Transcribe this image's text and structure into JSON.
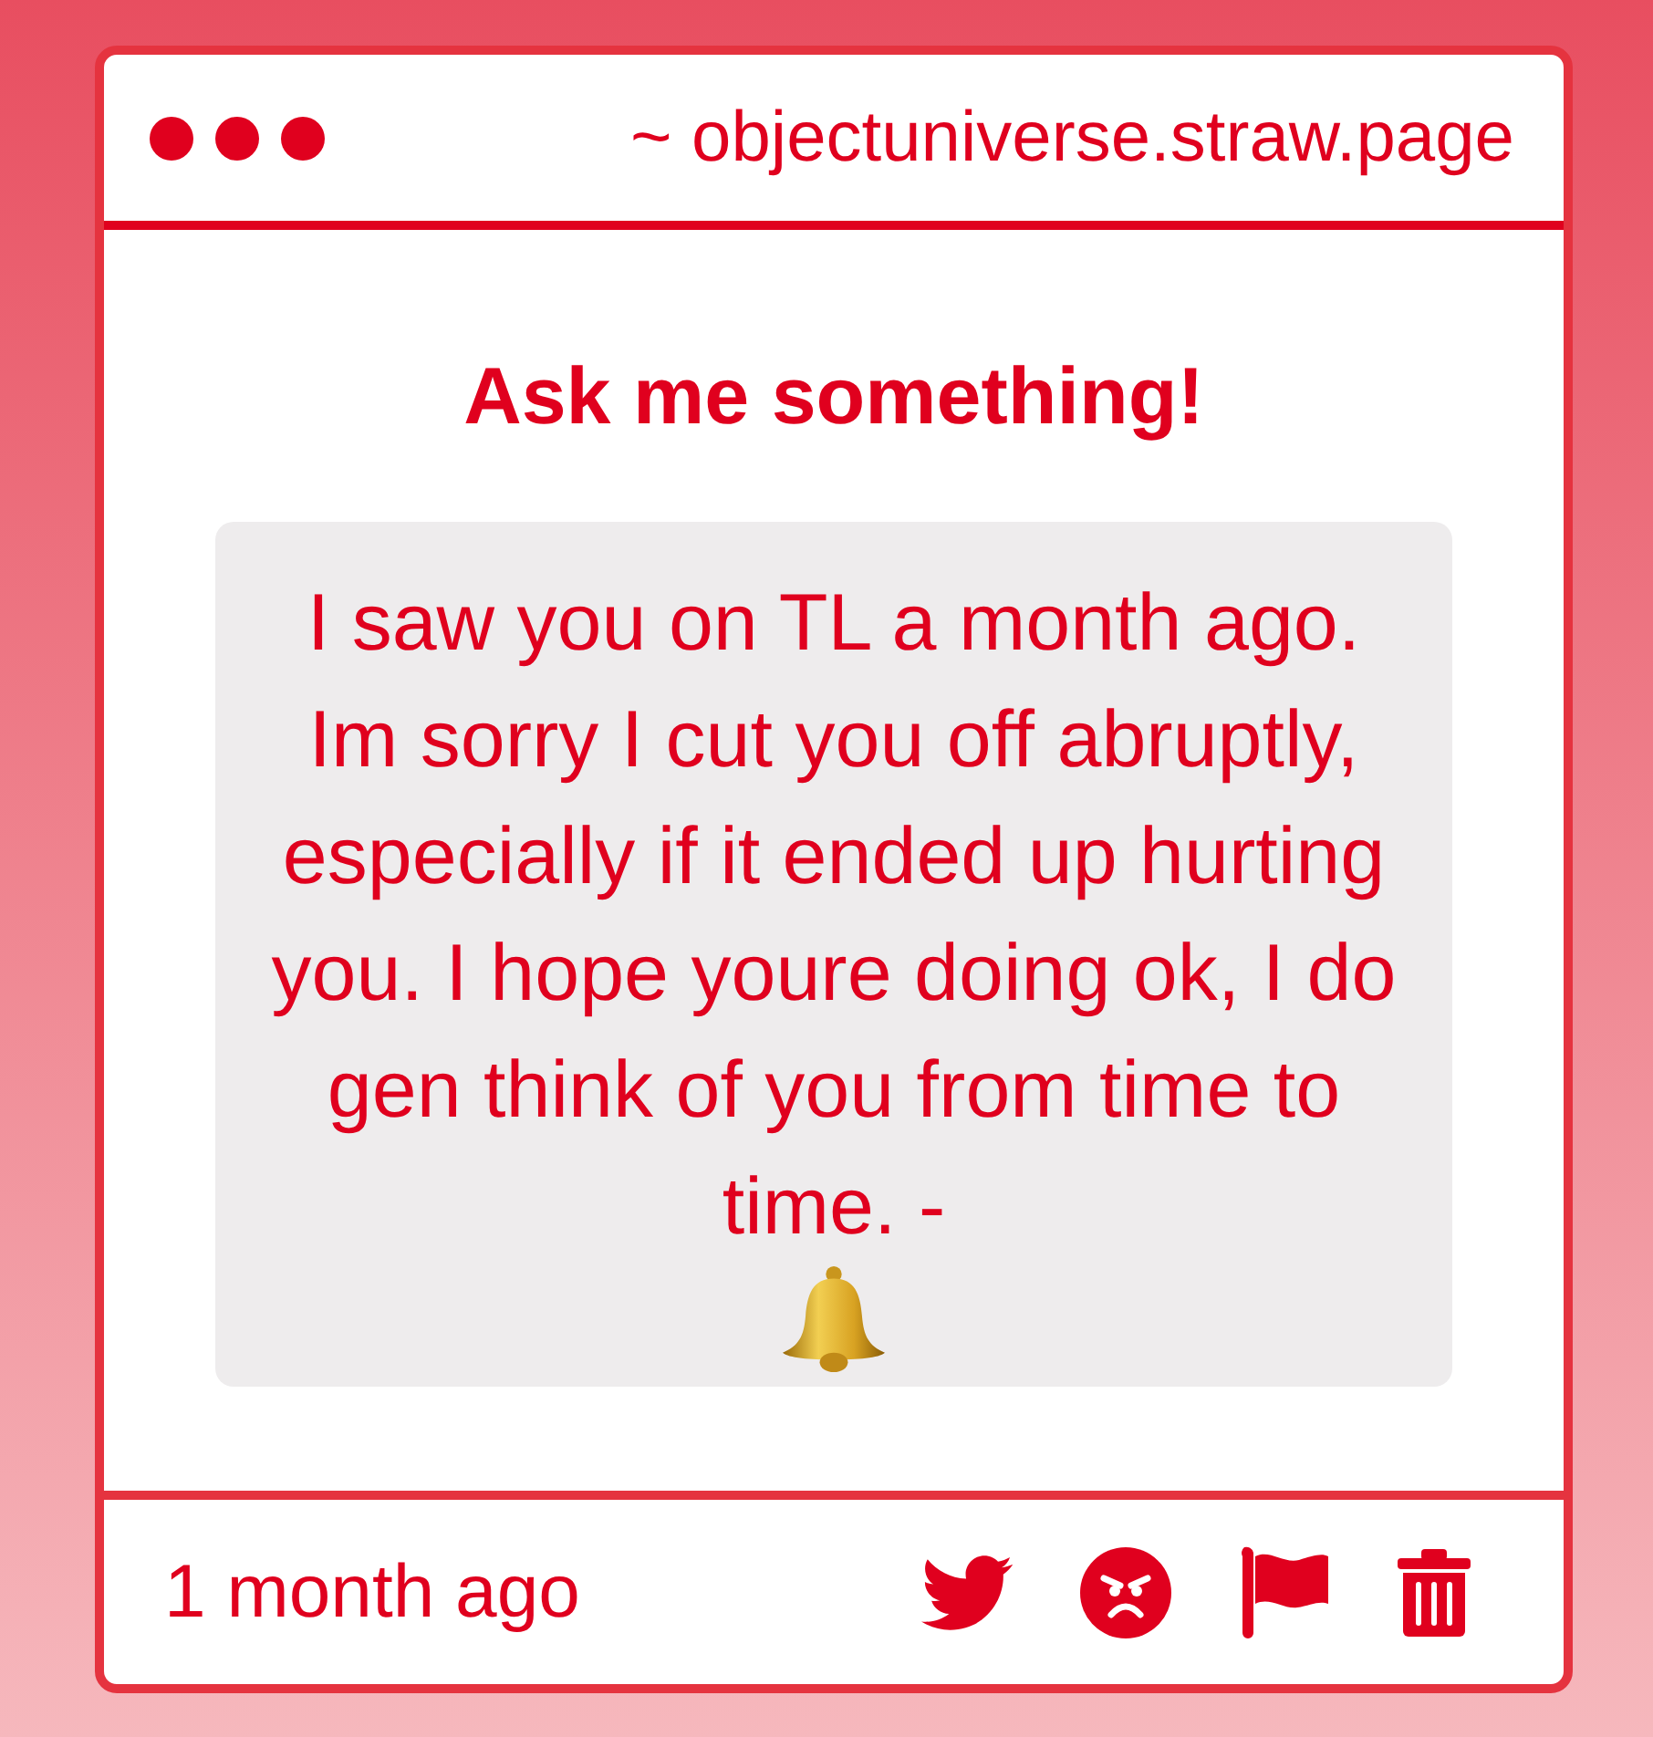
{
  "header": {
    "url": "~ objectuniverse.straw.page"
  },
  "title": "Ask me something!",
  "message": {
    "text": "I saw you on TL a month ago. Im sorry I cut you off abruptly, especially if it ended up hurting you. I hope youre doing ok, I do gen think of you from time to time. -"
  },
  "footer": {
    "time": "1 month ago"
  }
}
